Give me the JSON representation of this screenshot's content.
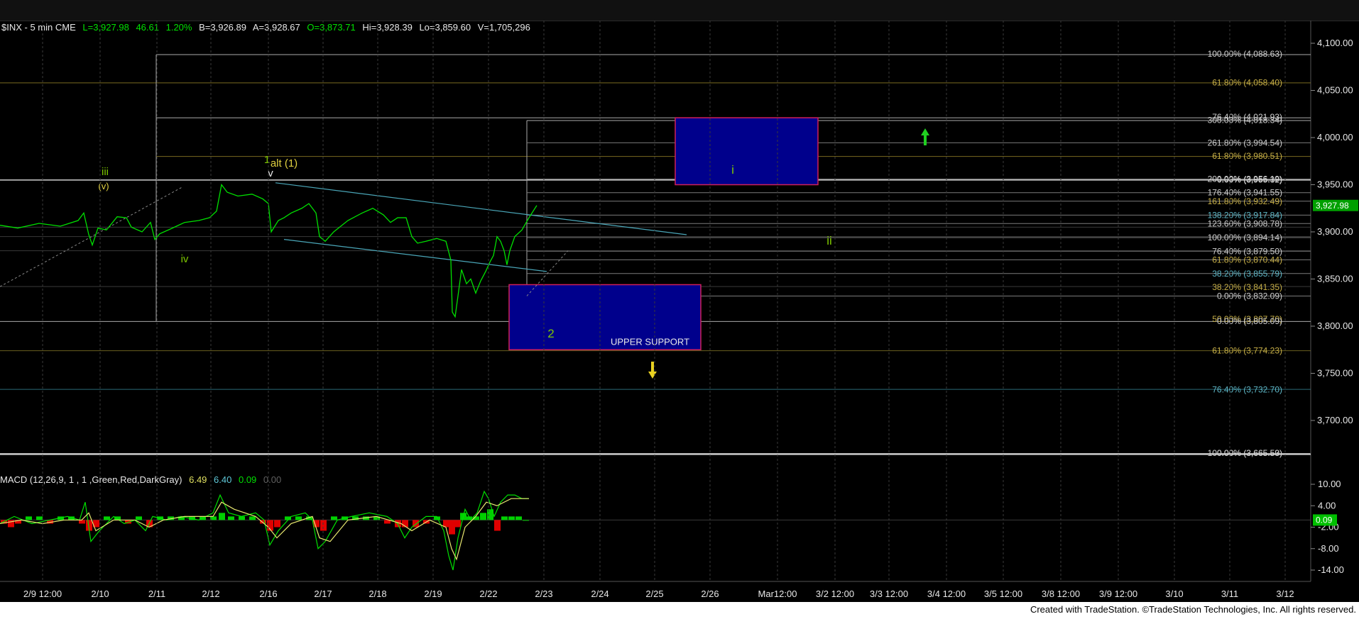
{
  "header": {
    "symbol": "$INX - 5 min  CME",
    "last": "L=3,927.98",
    "change": "46.61",
    "change_pct": "1.20%",
    "bid": "B=3,926.89",
    "ask": "A=3,928.67",
    "open": "O=3,873.71",
    "high": "Hi=3,928.39",
    "low": "Lo=3,859.60",
    "volume": "V=1,705,296"
  },
  "macd_header": {
    "label": "MACD (12,26,9, 1 , 1 ,Green,Red,DarkGray)",
    "v1": "6.49",
    "v2": "6.40",
    "v3": "0.09",
    "v4": "0.00"
  },
  "footer": "Created with TradeStation. ©TradeStation Technologies, Inc. All rights reserved.",
  "colors": {
    "background": "#000000",
    "price_line": "#00e000",
    "macd_line": "#00e000",
    "signal_line": "#e8e870",
    "hist_pos": "#00d000",
    "hist_neg": "#e00000",
    "box_fill": "#00008c",
    "box_border": "#d0205a",
    "wave_green": "#7ec800",
    "wave_yellow": "#e0d040"
  },
  "chart_data": [
    {
      "type": "line",
      "title": "$INX - 5 min",
      "y_axis_ticks": [
        "4,100.00",
        "4,050.00",
        "4,000.00",
        "3,950.00",
        "3,900.00",
        "3,850.00",
        "3,800.00",
        "3,750.00",
        "3,700.00"
      ],
      "ylim": [
        3655,
        4110
      ],
      "x_tick_labels": [
        "2/9 12:00",
        "2/10",
        "2/11",
        "2/12",
        "2/16",
        "2/17",
        "2/18",
        "2/19",
        "2/22",
        "2/23",
        "2/24",
        "2/25",
        "2/26",
        "Mar12:00",
        "3/2 12:00",
        "3/3 12:00",
        "3/4 12:00",
        "3/5 12:00",
        "3/8 12:00",
        "3/9 12:00",
        "3/10",
        "3/11",
        "3/12"
      ],
      "last_price_label": "3,927.98",
      "price_points": [
        [
          0,
          3907
        ],
        [
          25,
          3904
        ],
        [
          55,
          3909
        ],
        [
          85,
          3906
        ],
        [
          110,
          3912
        ],
        [
          118,
          3920
        ],
        [
          125,
          3897
        ],
        [
          130,
          3886
        ],
        [
          138,
          3904
        ],
        [
          150,
          3902
        ],
        [
          165,
          3916
        ],
        [
          178,
          3915
        ],
        [
          185,
          3905
        ],
        [
          200,
          3900
        ],
        [
          212,
          3910
        ],
        [
          218,
          3892
        ],
        [
          225,
          3898
        ],
        [
          240,
          3903
        ],
        [
          260,
          3910
        ],
        [
          280,
          3912
        ],
        [
          295,
          3915
        ],
        [
          305,
          3922
        ],
        [
          312,
          3950
        ],
        [
          320,
          3942
        ],
        [
          335,
          3938
        ],
        [
          355,
          3940
        ],
        [
          370,
          3935
        ],
        [
          378,
          3930
        ],
        [
          382,
          3900
        ],
        [
          392,
          3912
        ],
        [
          400,
          3915
        ],
        [
          410,
          3920
        ],
        [
          425,
          3925
        ],
        [
          435,
          3930
        ],
        [
          445,
          3920
        ],
        [
          450,
          3895
        ],
        [
          458,
          3890
        ],
        [
          470,
          3900
        ],
        [
          490,
          3912
        ],
        [
          510,
          3920
        ],
        [
          525,
          3925
        ],
        [
          540,
          3918
        ],
        [
          550,
          3910
        ],
        [
          560,
          3915
        ],
        [
          572,
          3915
        ],
        [
          580,
          3895
        ],
        [
          588,
          3888
        ],
        [
          600,
          3890
        ],
        [
          615,
          3893
        ],
        [
          628,
          3890
        ],
        [
          635,
          3870
        ],
        [
          637,
          3815
        ],
        [
          641,
          3810
        ],
        [
          645,
          3832
        ],
        [
          650,
          3860
        ],
        [
          657,
          3845
        ],
        [
          663,
          3850
        ],
        [
          670,
          3835
        ],
        [
          677,
          3848
        ],
        [
          684,
          3858
        ],
        [
          690,
          3868
        ],
        [
          695,
          3875
        ],
        [
          700,
          3895
        ],
        [
          705,
          3890
        ],
        [
          710,
          3880
        ],
        [
          714,
          3865
        ],
        [
          718,
          3880
        ],
        [
          725,
          3895
        ],
        [
          735,
          3902
        ],
        [
          745,
          3915
        ],
        [
          756,
          3928
        ]
      ],
      "boxes": [
        {
          "label": "i",
          "from": 3950,
          "to": 4021
        },
        {
          "label": "UPPER SUPPORT",
          "from": 3775,
          "to": 3844
        }
      ],
      "fib_levels": [
        {
          "label": "100.00% (4,088.63)",
          "value": 4088.63
        },
        {
          "label": "61.80% (4,058.40)",
          "value": 4058.4
        },
        {
          "label": "76.40% (4,021.93)",
          "value": 4021.93
        },
        {
          "label": "300.00% (4,018.34)",
          "value": 4018.34
        },
        {
          "label": "261.80% (3,994.54)",
          "value": 3994.54
        },
        {
          "label": "61.80% (3,980.51)",
          "value": 3980.51
        },
        {
          "label": "0.00% (3,955.32)",
          "value": 3955.32
        },
        {
          "label": "200.00% (3,956.19)",
          "value": 3956.19
        },
        {
          "label": "176.40% (3,941.55)",
          "value": 3941.55
        },
        {
          "label": "161.80% (3,932.49)",
          "value": 3932.49
        },
        {
          "label": "138.20% (3,917.84)",
          "value": 3917.84
        },
        {
          "label": "123.60% (3,908.78)",
          "value": 3908.78
        },
        {
          "label": "100.00% (3,894.14)",
          "value": 3894.14
        },
        {
          "label": "76.40% (3,879.50)",
          "value": 3879.5
        },
        {
          "label": "61.80% (3,870.44)",
          "value": 3870.44
        },
        {
          "label": "38.20% (3,855.79)",
          "value": 3855.79
        },
        {
          "label": "38.20% (3,841.35)",
          "value": 3841.35
        },
        {
          "label": "0.00% (3,832.09)",
          "value": 3832.09
        },
        {
          "label": "50.00% (3,807.70)",
          "value": 3807.7
        },
        {
          "label": "0.00% (3,805.09)",
          "value": 3805.09
        },
        {
          "label": "61.80% (3,774.23)",
          "value": 3774.23
        },
        {
          "label": "76.40% (3,732.70)",
          "value": 3732.7
        },
        {
          "label": "100.00% (3,665.50)",
          "value": 3665.5
        },
        {
          "label": "0.00% (3,665.53)",
          "value": 3665.53
        }
      ],
      "wave_labels": [
        "iii",
        "(v)",
        "iv",
        "1",
        "v",
        "alt (1)",
        "2",
        "i",
        "ii"
      ],
      "annotations": [
        "UPPER SUPPORT"
      ],
      "grid": true
    },
    {
      "type": "line",
      "title": "MACD (12,26,9, 1 , 1 ,Green,Red,DarkGray)",
      "y_axis_ticks": [
        "10.00",
        "4.00",
        "-2.00",
        "-8.00",
        "-14.00"
      ],
      "ylim": [
        -16,
        13
      ],
      "current_value_label": "0.09",
      "macd_points": [
        [
          0,
          -1
        ],
        [
          20,
          1
        ],
        [
          45,
          -1
        ],
        [
          70,
          0
        ],
        [
          95,
          1
        ],
        [
          112,
          0
        ],
        [
          120,
          5
        ],
        [
          128,
          -6
        ],
        [
          140,
          -3
        ],
        [
          160,
          1
        ],
        [
          175,
          -1
        ],
        [
          190,
          0
        ],
        [
          205,
          -3
        ],
        [
          215,
          1
        ],
        [
          235,
          0
        ],
        [
          255,
          1
        ],
        [
          280,
          0
        ],
        [
          300,
          2
        ],
        [
          310,
          7
        ],
        [
          322,
          2
        ],
        [
          340,
          1
        ],
        [
          360,
          2
        ],
        [
          372,
          0
        ],
        [
          380,
          -7
        ],
        [
          392,
          -3
        ],
        [
          410,
          1
        ],
        [
          430,
          2
        ],
        [
          440,
          0
        ],
        [
          448,
          -8
        ],
        [
          458,
          -6
        ],
        [
          475,
          0
        ],
        [
          495,
          1
        ],
        [
          520,
          2
        ],
        [
          545,
          1
        ],
        [
          560,
          -1
        ],
        [
          570,
          -5
        ],
        [
          580,
          -2
        ],
        [
          600,
          1
        ],
        [
          615,
          1
        ],
        [
          625,
          -3
        ],
        [
          632,
          -10
        ],
        [
          638,
          -14
        ],
        [
          645,
          -5
        ],
        [
          655,
          3
        ],
        [
          663,
          0
        ],
        [
          672,
          2
        ],
        [
          682,
          8
        ],
        [
          688,
          6
        ],
        [
          696,
          1
        ],
        [
          705,
          5
        ],
        [
          715,
          7
        ],
        [
          725,
          7
        ],
        [
          735,
          6
        ],
        [
          745,
          6
        ]
      ],
      "signal_points": [
        [
          0,
          -1
        ],
        [
          30,
          0
        ],
        [
          60,
          -1
        ],
        [
          90,
          0
        ],
        [
          115,
          0
        ],
        [
          125,
          2
        ],
        [
          135,
          -3
        ],
        [
          160,
          0
        ],
        [
          190,
          0
        ],
        [
          210,
          -2
        ],
        [
          230,
          0
        ],
        [
          260,
          1
        ],
        [
          300,
          1
        ],
        [
          312,
          5
        ],
        [
          330,
          3
        ],
        [
          360,
          1
        ],
        [
          378,
          -2
        ],
        [
          390,
          -5
        ],
        [
          410,
          -1
        ],
        [
          440,
          1
        ],
        [
          450,
          -5
        ],
        [
          465,
          -6
        ],
        [
          490,
          0
        ],
        [
          530,
          1
        ],
        [
          565,
          -1
        ],
        [
          580,
          -3
        ],
        [
          605,
          0
        ],
        [
          628,
          -2
        ],
        [
          636,
          -8
        ],
        [
          643,
          -11
        ],
        [
          655,
          -2
        ],
        [
          670,
          1
        ],
        [
          685,
          5
        ],
        [
          700,
          4
        ],
        [
          720,
          6
        ],
        [
          745,
          6
        ]
      ],
      "histogram": [
        [
          5,
          -1
        ],
        [
          15,
          -2
        ],
        [
          25,
          -1
        ],
        [
          40,
          1
        ],
        [
          55,
          1
        ],
        [
          70,
          -1
        ],
        [
          85,
          1
        ],
        [
          100,
          1
        ],
        [
          115,
          -1
        ],
        [
          125,
          -3
        ],
        [
          135,
          -2
        ],
        [
          150,
          1
        ],
        [
          165,
          1
        ],
        [
          180,
          -1
        ],
        [
          195,
          1
        ],
        [
          210,
          -2
        ],
        [
          225,
          1
        ],
        [
          240,
          1
        ],
        [
          255,
          1
        ],
        [
          270,
          1
        ],
        [
          285,
          1
        ],
        [
          300,
          1
        ],
        [
          312,
          2
        ],
        [
          325,
          1
        ],
        [
          340,
          1
        ],
        [
          355,
          1
        ],
        [
          370,
          -1
        ],
        [
          380,
          -3
        ],
        [
          390,
          -2
        ],
        [
          405,
          1
        ],
        [
          420,
          1
        ],
        [
          435,
          1
        ],
        [
          445,
          -2
        ],
        [
          455,
          -3
        ],
        [
          470,
          1
        ],
        [
          485,
          1
        ],
        [
          500,
          1
        ],
        [
          515,
          1
        ],
        [
          530,
          1
        ],
        [
          545,
          -1
        ],
        [
          560,
          -2
        ],
        [
          570,
          -2
        ],
        [
          585,
          -2
        ],
        [
          600,
          -1
        ],
        [
          615,
          1
        ],
        [
          628,
          -2
        ],
        [
          636,
          -4
        ],
        [
          644,
          -2
        ],
        [
          652,
          2
        ],
        [
          660,
          1
        ],
        [
          670,
          1
        ],
        [
          680,
          2
        ],
        [
          690,
          3
        ],
        [
          700,
          -3
        ],
        [
          710,
          1
        ],
        [
          720,
          1
        ],
        [
          730,
          1
        ],
        [
          740,
          0
        ]
      ]
    }
  ]
}
